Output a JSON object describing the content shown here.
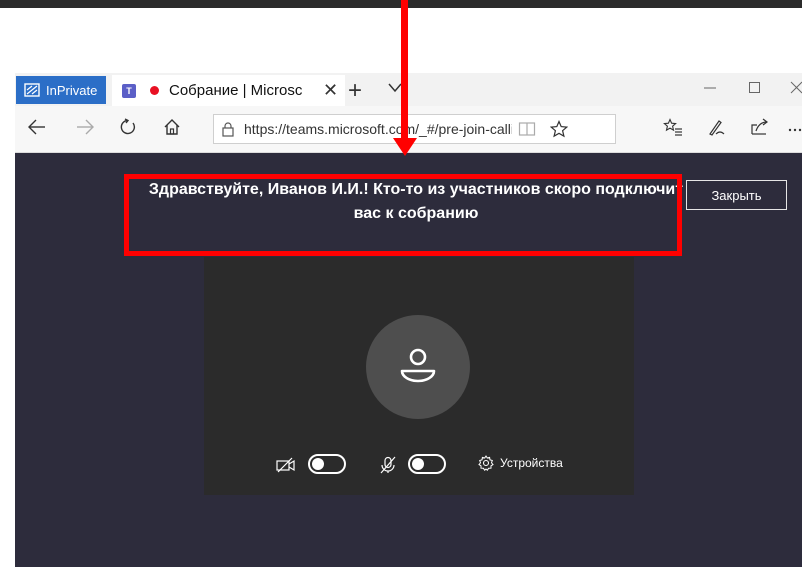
{
  "browser": {
    "inprivate_label": "InPrivate",
    "tab_title": "Собрание | Microsс",
    "tab_close": "✕",
    "new_tab": "+",
    "url": "https://teams.microsoft.com/_#/pre-join-callii"
  },
  "meeting": {
    "banner_text": "Здравствуйте, Иванов И.И.! Кто-то из участников скоро подключит вас к собранию",
    "close_button": "Закрыть",
    "camera_toggle": "off",
    "mic_toggle": "off",
    "devices_label": "Устройства"
  },
  "colors": {
    "content_bg": "#2d2c3c",
    "card_bg": "#2b2b2b",
    "inprivate_bg": "#2b6ec7",
    "annotation_red": "#ff0000",
    "recording_dot": "#e81123"
  },
  "icons": [
    "inprivate-icon",
    "teams-icon",
    "recording-dot-icon",
    "back-icon",
    "forward-icon",
    "refresh-icon",
    "home-icon",
    "lock-icon",
    "reading-view-icon",
    "favorite-star-icon",
    "favorites-list-icon",
    "pen-icon",
    "share-icon",
    "more-icon",
    "person-icon",
    "camera-off-icon",
    "mic-off-icon",
    "gear-icon"
  ]
}
